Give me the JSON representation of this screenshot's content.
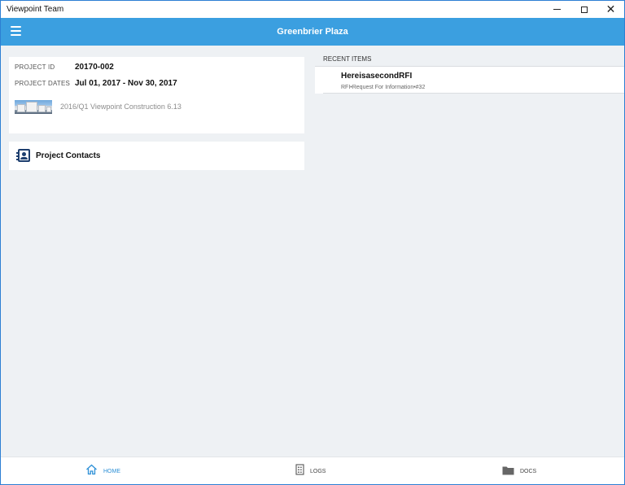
{
  "window": {
    "title": "Viewpoint Team",
    "controls": {
      "minimize": "—",
      "maximize": "☐",
      "close": "✕"
    }
  },
  "header": {
    "title": "Greenbrier Plaza",
    "menu_icon": "hamburger-icon",
    "bg_color": "#3b9fe0"
  },
  "project": {
    "id_label": "PROJECT ID",
    "id_value": "20170-002",
    "dates_label": "PROJECT DATES",
    "dates_value": "Jul 01, 2017 - Nov 30, 2017",
    "version": "2016/Q1 Viewpoint Construction 6.13",
    "thumbnail_icon": "building-photo"
  },
  "contacts": {
    "label": "Project Contacts",
    "icon": "contacts-book-icon"
  },
  "recent": {
    "header": "RECENT ITEMS",
    "items": [
      {
        "title": "HereisasecondRFI",
        "subtitle": "RFI•Request For Information•#32"
      }
    ]
  },
  "bottom_nav": {
    "items": [
      {
        "label": "HOME",
        "icon": "home-icon",
        "active": true,
        "color": "#2c8fd6"
      },
      {
        "label": "LOGS",
        "icon": "logs-icon",
        "active": false
      },
      {
        "label": "DOCS",
        "icon": "folder-icon",
        "active": false
      }
    ]
  }
}
